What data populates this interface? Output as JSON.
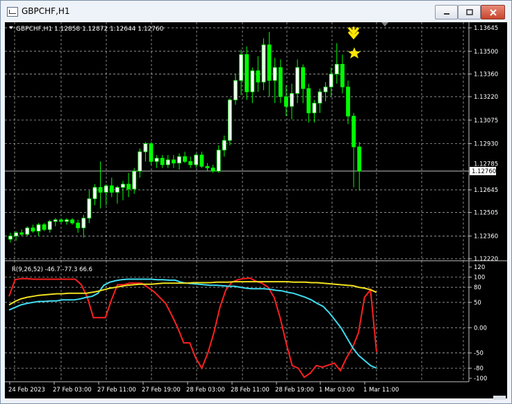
{
  "window": {
    "title": "GBPCHF,H1",
    "buttons": {
      "minimize": "minimize",
      "maximize": "maximize",
      "close": "close"
    }
  },
  "chart": {
    "symbol_header": "GBPCHF,H1  1.12858 1.12872 1.12644 1.12760",
    "price_axis_labels": [
      "1.13645",
      "1.13500",
      "1.13360",
      "1.13220",
      "1.13075",
      "1.12930",
      "1.12645",
      "1.12505",
      "1.12360",
      "1.12220"
    ],
    "current_price_label": "1.12760",
    "hidden_price_label": "1.12785",
    "time_axis_labels": [
      "24 Feb 2023",
      "27 Feb 03:00",
      "27 Feb 11:00",
      "27 Feb 19:00",
      "28 Feb 03:00",
      "28 Feb 11:00",
      "28 Feb 19:00",
      "1 Mar 03:00",
      "1 Mar 11:00"
    ],
    "colors": {
      "background": "#000000",
      "bull": "#ffffff",
      "bear": "#00ff00",
      "grid": "#c0c0c0"
    },
    "signal_icons": [
      "arrow-down-icon",
      "star-icon"
    ]
  },
  "indicator": {
    "label": "R(9,26,52) -46.7 -77.3 66.6",
    "axis_labels": [
      "120",
      "100",
      "80",
      "50",
      "0.00",
      "-50",
      "-80",
      "-100"
    ],
    "colors": {
      "fast": "#ff2020",
      "medium": "#3fdcf0",
      "slow": "#f0e020"
    }
  },
  "chart_data": {
    "type": "candlestick",
    "y_range": [
      1.1222,
      1.13645
    ],
    "candles": [
      [
        1.1234,
        1.1238,
        1.1232,
        1.1236
      ],
      [
        1.1236,
        1.1239,
        1.1233,
        1.1238
      ],
      [
        1.1238,
        1.124,
        1.1236,
        1.1237
      ],
      [
        1.1237,
        1.1242,
        1.1236,
        1.1241
      ],
      [
        1.1241,
        1.1243,
        1.1238,
        1.1239
      ],
      [
        1.1239,
        1.1244,
        1.1236,
        1.1243
      ],
      [
        1.1243,
        1.1244,
        1.1239,
        1.124
      ],
      [
        1.124,
        1.1246,
        1.1238,
        1.1245
      ],
      [
        1.1245,
        1.1247,
        1.1242,
        1.1246
      ],
      [
        1.1246,
        1.1247,
        1.1244,
        1.1245
      ],
      [
        1.1245,
        1.1247,
        1.1243,
        1.1246
      ],
      [
        1.1246,
        1.1247,
        1.1243,
        1.1244
      ],
      [
        1.1244,
        1.1246,
        1.1238,
        1.1241
      ],
      [
        1.1241,
        1.1249,
        1.1235,
        1.1247
      ],
      [
        1.1247,
        1.1264,
        1.1244,
        1.1259
      ],
      [
        1.1259,
        1.1268,
        1.1255,
        1.1266
      ],
      [
        1.1266,
        1.1282,
        1.1253,
        1.1263
      ],
      [
        1.1263,
        1.1268,
        1.1255,
        1.1267
      ],
      [
        1.1267,
        1.1272,
        1.126,
        1.1263
      ],
      [
        1.1263,
        1.1267,
        1.1256,
        1.1266
      ],
      [
        1.1266,
        1.127,
        1.1258,
        1.1268
      ],
      [
        1.1268,
        1.1275,
        1.126,
        1.1265
      ],
      [
        1.1265,
        1.1278,
        1.1262,
        1.1276
      ],
      [
        1.1276,
        1.129,
        1.1272,
        1.1288
      ],
      [
        1.1288,
        1.1294,
        1.1282,
        1.1293
      ],
      [
        1.1293,
        1.1294,
        1.128,
        1.1282
      ],
      [
        1.1282,
        1.1286,
        1.1278,
        1.1284
      ],
      [
        1.1284,
        1.1286,
        1.1278,
        1.128
      ],
      [
        1.128,
        1.1286,
        1.1278,
        1.1283
      ],
      [
        1.1283,
        1.1286,
        1.1278,
        1.1281
      ],
      [
        1.1281,
        1.1287,
        1.1277,
        1.1285
      ],
      [
        1.1285,
        1.1288,
        1.1281,
        1.1282
      ],
      [
        1.1282,
        1.1285,
        1.1278,
        1.128
      ],
      [
        1.128,
        1.1287,
        1.1278,
        1.1286
      ],
      [
        1.1286,
        1.1288,
        1.1278,
        1.1279
      ],
      [
        1.1279,
        1.1281,
        1.1276,
        1.1278
      ],
      [
        1.1278,
        1.128,
        1.1275,
        1.1276
      ],
      [
        1.1276,
        1.1292,
        1.1275,
        1.1289
      ],
      [
        1.1289,
        1.1298,
        1.1285,
        1.1295
      ],
      [
        1.1295,
        1.1321,
        1.1292,
        1.132
      ],
      [
        1.132,
        1.1336,
        1.1317,
        1.1332
      ],
      [
        1.1332,
        1.1351,
        1.1323,
        1.1348
      ],
      [
        1.1348,
        1.1353,
        1.132,
        1.1325
      ],
      [
        1.1325,
        1.134,
        1.1318,
        1.1338
      ],
      [
        1.1338,
        1.1347,
        1.1325,
        1.1331
      ],
      [
        1.1331,
        1.1358,
        1.1326,
        1.1354
      ],
      [
        1.1354,
        1.1362,
        1.1322,
        1.1332
      ],
      [
        1.1332,
        1.1346,
        1.1318,
        1.134
      ],
      [
        1.134,
        1.1345,
        1.1318,
        1.1322
      ],
      [
        1.1322,
        1.1329,
        1.131,
        1.1316
      ],
      [
        1.1316,
        1.133,
        1.1308,
        1.1324
      ],
      [
        1.1324,
        1.1345,
        1.1318,
        1.134
      ],
      [
        1.134,
        1.1342,
        1.1318,
        1.1327
      ],
      [
        1.1327,
        1.133,
        1.1306,
        1.1312
      ],
      [
        1.1312,
        1.132,
        1.1306,
        1.1318
      ],
      [
        1.1318,
        1.1327,
        1.1312,
        1.1325
      ],
      [
        1.1325,
        1.1331,
        1.1319,
        1.1328
      ],
      [
        1.1328,
        1.134,
        1.1322,
        1.1336
      ],
      [
        1.1336,
        1.1355,
        1.133,
        1.1342
      ],
      [
        1.1342,
        1.1348,
        1.1324,
        1.1328
      ],
      [
        1.1328,
        1.1332,
        1.1305,
        1.131
      ],
      [
        1.131,
        1.1312,
        1.1266,
        1.1291
      ],
      [
        1.1291,
        1.1294,
        1.1264,
        1.1276
      ]
    ],
    "indicator_series": [
      {
        "name": "fast",
        "values": [
          62,
          95,
          97,
          97,
          96,
          96,
          96,
          96,
          96,
          96,
          96,
          96,
          85,
          60,
          20,
          20,
          20,
          55,
          85,
          85,
          88,
          88,
          88,
          80,
          72,
          60,
          48,
          25,
          0,
          -30,
          -30,
          -60,
          -80,
          -50,
          -10,
          40,
          75,
          90,
          95,
          97,
          98,
          92,
          88,
          80,
          60,
          20,
          -30,
          -75,
          -80,
          -98,
          -90,
          -75,
          -78,
          -74,
          -70,
          -85,
          -60,
          -40,
          -10,
          60,
          75,
          -48
        ]
      },
      {
        "name": "medium",
        "values": [
          35,
          40,
          45,
          48,
          50,
          52,
          52,
          53,
          53,
          55,
          55,
          55,
          57,
          60,
          62,
          68,
          84,
          90,
          93,
          95,
          96,
          96,
          96,
          96,
          96,
          95,
          95,
          94,
          94,
          90,
          88,
          87,
          86,
          85,
          84,
          84,
          83,
          82,
          82,
          80,
          78,
          77,
          77,
          77,
          76,
          74,
          73,
          70,
          68,
          64,
          60,
          55,
          48,
          42,
          30,
          15,
          0,
          -20,
          -40,
          -55,
          -65,
          -75,
          -80
        ]
      },
      {
        "name": "slow",
        "values": [
          45,
          52,
          57,
          60,
          62,
          64,
          65,
          66,
          67,
          67,
          68,
          68,
          68,
          68,
          70,
          72,
          75,
          78,
          80,
          82,
          84,
          85,
          86,
          86,
          86,
          87,
          88,
          88,
          88,
          88,
          88,
          89,
          89,
          89,
          89,
          90,
          90,
          90,
          91,
          91,
          91,
          91,
          91,
          91,
          91,
          91,
          91,
          91,
          90,
          90,
          90,
          89,
          89,
          88,
          87,
          86,
          85,
          84,
          83,
          80,
          78,
          75,
          70
        ]
      }
    ]
  }
}
